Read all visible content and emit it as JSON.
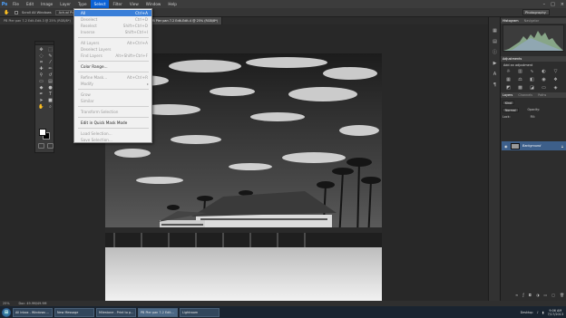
{
  "menubar": {
    "items": [
      "File",
      "Edit",
      "Image",
      "Layer",
      "Type",
      "Select",
      "Filter",
      "View",
      "Window",
      "Help"
    ],
    "active_index": 5
  },
  "options_bar": {
    "scroll_all_windows": "Scroll All Windows",
    "actual_pixels": "Actual Pixels",
    "workspace": "Photography"
  },
  "tabs": [
    {
      "label": "PB Pier pan 7-2 Edit-Edit-3 @ 25% (RGB/8*)",
      "active": false
    },
    {
      "label": "PB Pier pan 7-2 Edit-Edit @ 25% (RGB/8*)",
      "active": false
    },
    {
      "label": "PB Pier pan 7-2 Edit-Edit-4 @ 25% (RGB/8*)",
      "active": true
    }
  ],
  "select_menu": [
    {
      "label": "All",
      "shortcut": "Ctrl+A",
      "highlight": true
    },
    {
      "label": "Deselect",
      "shortcut": "Ctrl+D",
      "disabled": true
    },
    {
      "label": "Reselect",
      "shortcut": "Shift+Ctrl+D",
      "disabled": true
    },
    {
      "label": "Inverse",
      "shortcut": "Shift+Ctrl+I",
      "disabled": true
    },
    {
      "label": "All Layers",
      "shortcut": "Alt+Ctrl+A",
      "disabled": true
    },
    {
      "label": "Deselect Layers",
      "shortcut": "",
      "disabled": true
    },
    {
      "label": "Find Layers",
      "shortcut": "Alt+Shift+Ctrl+F",
      "disabled": true
    },
    {
      "label": "Color Range...",
      "shortcut": ""
    },
    {
      "label": "Refine Mask...",
      "shortcut": "Alt+Ctrl+R",
      "disabled": true
    },
    {
      "label": "Modify",
      "shortcut": "",
      "disabled": true,
      "submenu": true
    },
    {
      "label": "Grow",
      "shortcut": "",
      "disabled": true
    },
    {
      "label": "Similar",
      "shortcut": "",
      "disabled": true
    },
    {
      "label": "Transform Selection",
      "shortcut": "",
      "disabled": true
    },
    {
      "label": "Edit in Quick Mask Mode",
      "shortcut": ""
    },
    {
      "label": "Load Selection...",
      "shortcut": "",
      "disabled": true
    },
    {
      "label": "Save Selection...",
      "shortcut": "",
      "disabled": true
    }
  ],
  "panels": {
    "histogram_tab": "Histogram",
    "navigator_tab": "Navigator",
    "adjustments_tab": "Adjustments",
    "adjustments_title": "Add an adjustment",
    "layers_tab": "Layers",
    "channels_tab": "Channels",
    "paths_tab": "Paths",
    "kind_label": "Kind",
    "blend_mode": "Normal",
    "opacity_label": "Opacity:",
    "lock_label": "Lock:",
    "fill_label": "Fill:",
    "layer_name": "Background"
  },
  "status": {
    "zoom": "25%",
    "doc": "Doc: 49.9M/49.9M"
  },
  "taskbar": {
    "tasks": [
      {
        "label": "All inbox - Windows ...",
        "active": false
      },
      {
        "label": "New Message",
        "active": false
      },
      {
        "label": "Milestone - Print to p...",
        "active": false
      },
      {
        "label": "PB Pier pan 7-2 Edit...",
        "active": true
      },
      {
        "label": "Lightroom",
        "active": false
      }
    ],
    "desktop_label": "Desktop",
    "time": "9:06 AM",
    "date": "7/17/2013"
  },
  "colors": {
    "menu_highlight": "#3a7fd8",
    "active_menu": "#0b62d6",
    "selected_layer": "#3d5f8a"
  }
}
